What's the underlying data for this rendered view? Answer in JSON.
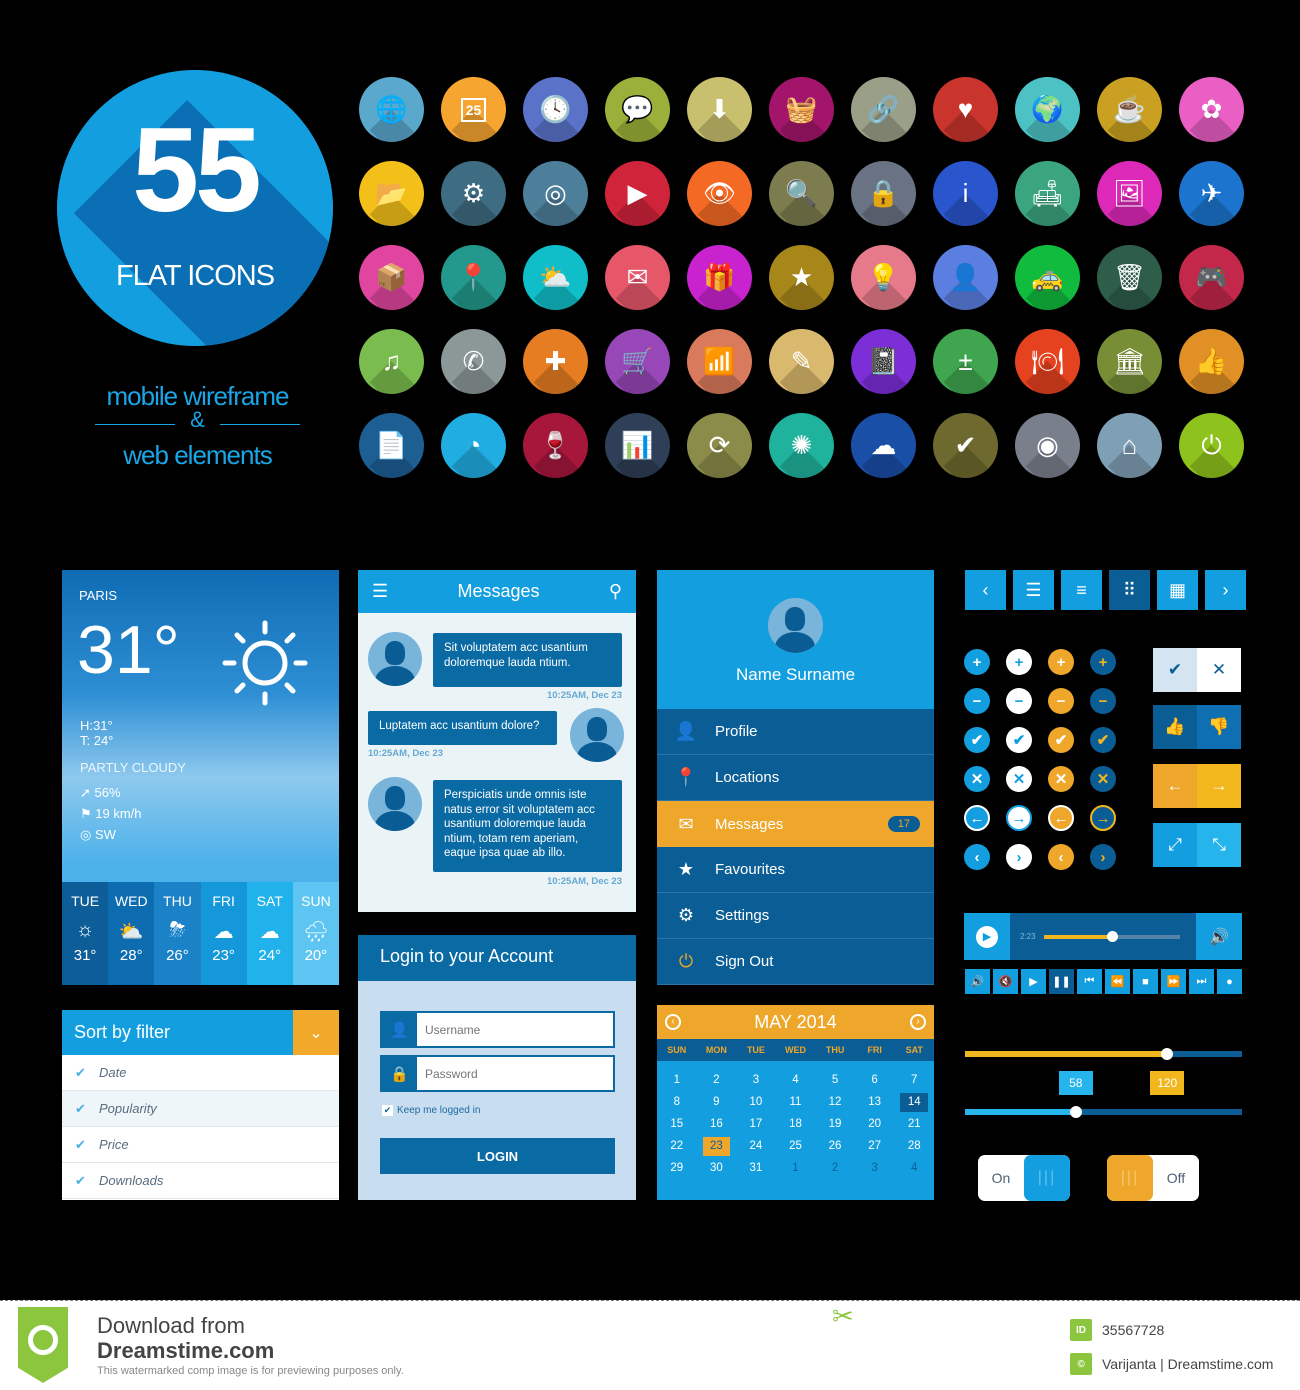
{
  "hero": {
    "number": "55",
    "subtitle": "FLAT ICONS",
    "tagline_top": "mobile wireframe",
    "tagline_amp": "&",
    "tagline_bottom": "web elements",
    "color": "#139fdf"
  },
  "icons": [
    {
      "name": "globe-icon",
      "glyph": "🌐",
      "color": "#5aa8cc"
    },
    {
      "name": "calendar-icon",
      "glyph": "25",
      "color": "#f6a531"
    },
    {
      "name": "clock-icon",
      "glyph": "🕓",
      "color": "#5a73c9"
    },
    {
      "name": "chat-icon",
      "glyph": "💬",
      "color": "#9bb03a"
    },
    {
      "name": "download-icon",
      "glyph": "⬇",
      "color": "#c8c06e"
    },
    {
      "name": "basket-icon",
      "glyph": "🧺",
      "color": "#a3156b"
    },
    {
      "name": "link-icon",
      "glyph": "🔗",
      "color": "#9a9f88"
    },
    {
      "name": "heart-icon",
      "glyph": "♥",
      "color": "#c9352c"
    },
    {
      "name": "globe-pin-icon",
      "glyph": "🌍",
      "color": "#4dc2c4"
    },
    {
      "name": "coffee-icon",
      "glyph": "☕",
      "color": "#c9a022"
    },
    {
      "name": "flower-icon",
      "glyph": "✿",
      "color": "#e95fc4"
    },
    {
      "name": "folder-icon",
      "glyph": "📂",
      "color": "#f2c019"
    },
    {
      "name": "settings-wrench-icon",
      "glyph": "⚙",
      "color": "#3e6c82"
    },
    {
      "name": "target-icon",
      "glyph": "◎",
      "color": "#4d7f9a"
    },
    {
      "name": "video-icon",
      "glyph": "▶",
      "color": "#d0243b"
    },
    {
      "name": "eye-icon",
      "glyph": "👁",
      "color": "#f46a24"
    },
    {
      "name": "search-icon",
      "glyph": "🔍",
      "color": "#7c7c4f"
    },
    {
      "name": "lock-icon",
      "glyph": "🔒",
      "color": "#6a7384"
    },
    {
      "name": "info-icon",
      "glyph": "i",
      "color": "#2956cc"
    },
    {
      "name": "hotel-icon",
      "glyph": "🛋",
      "color": "#3aa57e"
    },
    {
      "name": "image-icon",
      "glyph": "🖼",
      "color": "#dc29b8"
    },
    {
      "name": "airplane-icon",
      "glyph": "✈",
      "color": "#1c74cf"
    },
    {
      "name": "box-icon",
      "glyph": "📦",
      "color": "#e0469f"
    },
    {
      "name": "map-pin-icon",
      "glyph": "📍",
      "color": "#23998d"
    },
    {
      "name": "weather-icon",
      "glyph": "⛅",
      "color": "#10bec9"
    },
    {
      "name": "mail-icon",
      "glyph": "✉",
      "color": "#e6576a"
    },
    {
      "name": "gift-icon",
      "glyph": "🎁",
      "color": "#c823cf"
    },
    {
      "name": "star-icon",
      "glyph": "★",
      "color": "#a8871a"
    },
    {
      "name": "bulb-icon",
      "glyph": "💡",
      "color": "#e77a8a"
    },
    {
      "name": "user-icon",
      "glyph": "👤",
      "color": "#5b7fe0"
    },
    {
      "name": "taxi-icon",
      "glyph": "🚕",
      "color": "#10bb3e"
    },
    {
      "name": "trash-icon",
      "glyph": "🗑",
      "color": "#2e5d4a"
    },
    {
      "name": "gamepad-icon",
      "glyph": "🎮",
      "color": "#c3284b"
    },
    {
      "name": "music-icon",
      "glyph": "♫",
      "color": "#7abd4e"
    },
    {
      "name": "phone-icon",
      "glyph": "✆",
      "color": "#8c9898"
    },
    {
      "name": "first-aid-icon",
      "glyph": "✚",
      "color": "#e67d22"
    },
    {
      "name": "cart-icon",
      "glyph": "🛒",
      "color": "#9747b8"
    },
    {
      "name": "wifi-icon",
      "glyph": "📶",
      "color": "#d97a5c"
    },
    {
      "name": "pencil-icon",
      "glyph": "✎",
      "color": "#d9b96d"
    },
    {
      "name": "notebook-icon",
      "glyph": "📓",
      "color": "#7c2ed7"
    },
    {
      "name": "calculator-icon",
      "glyph": "±",
      "color": "#3fa54f"
    },
    {
      "name": "restaurant-icon",
      "glyph": "🍽",
      "color": "#e5421f"
    },
    {
      "name": "bank-icon",
      "glyph": "🏛",
      "color": "#778e37"
    },
    {
      "name": "thumbs-up-icon",
      "glyph": "👍",
      "color": "#e09025"
    },
    {
      "name": "document-icon",
      "glyph": "📄",
      "color": "#1d5f93"
    },
    {
      "name": "pie-chart-icon",
      "glyph": "◔",
      "color": "#20aee2"
    },
    {
      "name": "wine-icon",
      "glyph": "🍷",
      "color": "#a7173c"
    },
    {
      "name": "bar-chart-icon",
      "glyph": "📊",
      "color": "#2f3f57"
    },
    {
      "name": "refresh-icon",
      "glyph": "⟳",
      "color": "#8c8c4a"
    },
    {
      "name": "network-icon",
      "glyph": "✺",
      "color": "#1fb29d"
    },
    {
      "name": "cloud-icon",
      "glyph": "☁",
      "color": "#1a4fa8"
    },
    {
      "name": "check-icon",
      "glyph": "✔",
      "color": "#6e6a2f"
    },
    {
      "name": "lifebuoy-icon",
      "glyph": "◉",
      "color": "#7a7f8c"
    },
    {
      "name": "home-icon",
      "glyph": "⌂",
      "color": "#7f9fb5"
    },
    {
      "name": "power-icon",
      "glyph": "⏻",
      "color": "#8ec21d"
    }
  ],
  "weather": {
    "city": "PARIS",
    "temperature": "31°",
    "high": "H:31°",
    "low": "T: 24°",
    "condition": "PARTLY CLOUDY",
    "humidity": "56%",
    "wind": "19 km/h",
    "direction": "SW",
    "forecast": [
      {
        "day": "TUE",
        "icon": "☼",
        "temp": "31°",
        "color": "#0c5d98"
      },
      {
        "day": "WED",
        "icon": "⛅",
        "temp": "28°",
        "color": "#0d6cb0"
      },
      {
        "day": "THU",
        "icon": "⛈",
        "temp": "26°",
        "color": "#1b82c7"
      },
      {
        "day": "FRI",
        "icon": "☁",
        "temp": "23°",
        "color": "#1598d9"
      },
      {
        "day": "SAT",
        "icon": "☁",
        "temp": "24°",
        "color": "#21b2ec"
      },
      {
        "day": "SUN",
        "icon": "🌧",
        "temp": "20°",
        "color": "#5ec5f2"
      }
    ]
  },
  "sort": {
    "title": "Sort by filter",
    "items": [
      "Date",
      "Popularity",
      "Price",
      "Downloads"
    ]
  },
  "messages": {
    "title": "Messages",
    "items": [
      {
        "text": "Sit voluptatem acc usantium doloremque lauda ntium.",
        "time": "10:25AM, Dec 23"
      },
      {
        "text": "Luptatem acc usantium dolore?",
        "time": "10:25AM, Dec 23"
      },
      {
        "text": "Perspiciatis unde omnis iste natus error sit voluptatem acc usantium doloremque lauda ntium, totam rem aperiam, eaque ipsa quae ab illo.",
        "time": "10:25AM, Dec 23"
      }
    ]
  },
  "login": {
    "title": "Login to your Account",
    "username_placeholder": "Username",
    "password_placeholder": "Password",
    "keep_label": "Keep me logged in",
    "keep_checked": true,
    "button": "LOGIN"
  },
  "menu": {
    "name": "Name Surname",
    "items": [
      {
        "label": "Profile",
        "icon": "👤"
      },
      {
        "label": "Locations",
        "icon": "📍"
      },
      {
        "label": "Messages",
        "icon": "✉",
        "badge": "17",
        "active": true
      },
      {
        "label": "Favourites",
        "icon": "★"
      },
      {
        "label": "Settings",
        "icon": "⚙"
      },
      {
        "label": "Sign Out",
        "icon": "⏻"
      }
    ]
  },
  "calendar": {
    "title": "MAY 2014",
    "dow": [
      "SUN",
      "MON",
      "TUE",
      "WED",
      "THU",
      "FRI",
      "SAT"
    ],
    "days": [
      "1",
      "2",
      "3",
      "4",
      "5",
      "6",
      "7",
      "8",
      "9",
      "10",
      "11",
      "12",
      "13",
      "14",
      "15",
      "16",
      "17",
      "18",
      "19",
      "20",
      "21",
      "22",
      "23",
      "24",
      "25",
      "26",
      "27",
      "28",
      "29",
      "30",
      "31",
      "1",
      "2",
      "3",
      "4"
    ],
    "selected": "14",
    "today": "23"
  },
  "controls": {
    "nav": [
      "‹",
      "☰",
      "≡",
      "⠿",
      "▦",
      "›"
    ],
    "nav_active": 3,
    "player": {
      "time": "2:23",
      "progress": 0.5
    },
    "media_buttons": [
      "🔊",
      "🔇",
      "▶",
      "❚❚",
      "⏮",
      "⏪",
      "■",
      "⏩",
      "⏭",
      "●"
    ],
    "media_active": 3,
    "slider1": {
      "value": 0.73,
      "label": "120"
    },
    "slider2": {
      "value": 0.4,
      "label": "58"
    },
    "toggle_on": "On",
    "toggle_off": "Off"
  },
  "footer": {
    "download": "Download from",
    "site": "Dreamstime.com",
    "note": "This watermarked comp image is for previewing purposes only.",
    "id_label": "ID",
    "id": "35567728",
    "copyright_label": "©",
    "credit": "Varijanta | Dreamstime.com"
  }
}
